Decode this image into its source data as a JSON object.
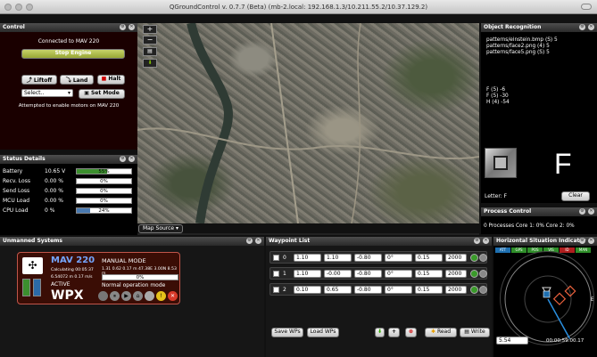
{
  "window": {
    "title": "QGroundControl v. 0.7.7 (Beta) (mb-2.local: 192.168.1.3/10.211.55.2/10.37.129.2)"
  },
  "control": {
    "title": "Control",
    "status": "Connected to MAV 220",
    "stop_engine": "Stop Engine",
    "liftoff": "Liftoff",
    "land": "Land",
    "halt": "Halt",
    "mode_select": "Select..",
    "set_mode": "Set Mode",
    "message": "Attempted to enable motors on MAV 220"
  },
  "status_details": {
    "title": "Status Details",
    "rows": [
      {
        "label": "Battery",
        "value": "10.65 V",
        "pct": "55%",
        "fill": 0.55,
        "color": "#3c8f2e"
      },
      {
        "label": "Recv. Loss",
        "value": "0.00 %",
        "pct": "0%",
        "fill": 0,
        "color": "#4a7ab0"
      },
      {
        "label": "Send Loss",
        "value": "0.00 %",
        "pct": "0%",
        "fill": 0,
        "color": "#4a7ab0"
      },
      {
        "label": "MCU Load",
        "value": "0.00 %",
        "pct": "0%",
        "fill": 0,
        "color": "#4a7ab0"
      },
      {
        "label": "CPU Load",
        "value": "0 %",
        "pct": "24%",
        "fill": 0.24,
        "color": "#4a7ab0"
      }
    ]
  },
  "map": {
    "source_label": "Map Source"
  },
  "object_recognition": {
    "title": "Object Recognition",
    "patterns": [
      "patterns/einstein.bmp (S) 5",
      "patterns/face2.png (4) 5",
      "patterns/face5.png (S) 5"
    ],
    "scores": [
      "F (5) -6",
      "F (5) -30",
      "H (4) -54"
    ],
    "big_letter": "F",
    "letter_label": "Letter: F",
    "clear": "Clear"
  },
  "process_control": {
    "title": "Process Control",
    "status": "0 Processes  Core 1: 0%  Core 2: 0%"
  },
  "unmanned": {
    "title": "Unmanned Systems",
    "name": "MAV 220",
    "mode": "MANUAL MODE",
    "calc": "Calculating 00:05:37",
    "coords": "1.31 0.62 0.17 m  47.38E 3.00N 8.53 m",
    "dist": "6.54072 m",
    "speed": "0.17 m/s",
    "progress": "0%",
    "state": "ACTIVE",
    "op_mode": "Normal operation mode",
    "type": "WPX"
  },
  "waypoints": {
    "title": "Waypoint List",
    "rows": [
      {
        "id": "0",
        "x": "1.10",
        "y": "1.10",
        "z": "-0.80",
        "yaw": "0°",
        "r": "0.15",
        "t": "2000"
      },
      {
        "id": "1",
        "x": "1.10",
        "y": "-0.00",
        "z": "-0.80",
        "yaw": "0°",
        "r": "0.15",
        "t": "2000"
      },
      {
        "id": "2",
        "x": "0.10",
        "y": "0.65",
        "z": "-0.80",
        "yaw": "0°",
        "r": "0.15",
        "t": "2000"
      }
    ],
    "save": "Save WPs",
    "load": "Load WPs",
    "read": "Read",
    "write": "Write"
  },
  "hsi": {
    "title": "Horizontal Situation Indicator",
    "value": "5.54",
    "time": "00:00:59.00.17",
    "n_label": "N",
    "e_label": "E",
    "status_labels": [
      "ATT",
      "GPS",
      "POS",
      "VIS",
      "ID",
      "MAN"
    ]
  }
}
